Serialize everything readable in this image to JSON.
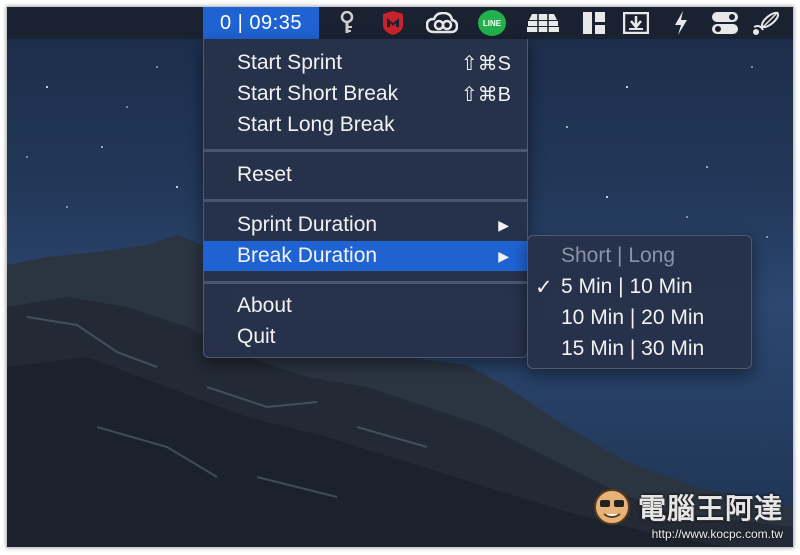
{
  "menubar": {
    "timer": "0 | 09:35",
    "icons": [
      "key-icon",
      "mcafee-shield-icon",
      "creative-cloud-icon",
      "line-app-icon",
      "stack-layers-icon",
      "layout-panels-icon",
      "download-box-icon",
      "lightning-icon",
      "toggle-switches-icon",
      "satellite-icon"
    ],
    "line_label": "LINE"
  },
  "menu": {
    "items": [
      {
        "label": "Start Sprint",
        "shortcut": "⇧⌘S"
      },
      {
        "label": "Start Short Break",
        "shortcut": "⇧⌘B"
      },
      {
        "label": "Start Long Break",
        "shortcut": ""
      },
      {
        "label": "Reset"
      },
      {
        "label": "Sprint Duration",
        "arrow": "▶"
      },
      {
        "label": "Break Duration",
        "arrow": "▶"
      },
      {
        "label": "About"
      },
      {
        "label": "Quit"
      }
    ]
  },
  "submenu": {
    "header": "Short | Long",
    "options": [
      {
        "label": "5 Min | 10 Min",
        "checked": true
      },
      {
        "label": "10 Min | 20 Min",
        "checked": false
      },
      {
        "label": "15 Min | 30 Min",
        "checked": false
      }
    ],
    "check": "✓"
  },
  "watermark": {
    "title": "電腦王阿達",
    "url": "http://www.kocpc.com.tw"
  },
  "colors": {
    "accent": "#1f63d3",
    "menubar": "#1a2131",
    "menu_bg": "#26324a",
    "line_green": "#22b14c",
    "mcafee_red": "#c8232c"
  }
}
